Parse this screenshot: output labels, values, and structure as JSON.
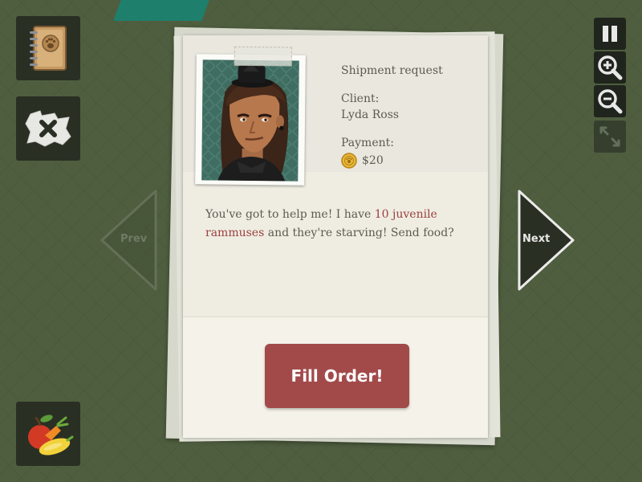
{
  "request": {
    "heading": "Shipment request",
    "client_label": "Client:",
    "client_name": "Lyda Ross",
    "payment_label": "Payment:",
    "payment_amount": "$20",
    "message": {
      "part1": "You've got to help me! I have ",
      "highlight1": "10 juvenile",
      "line_break_highlight": "rammuses",
      "part2": " and they're starving! Send food?"
    }
  },
  "navigation": {
    "prev_label": "Prev",
    "next_label": "Next"
  },
  "actions": {
    "fill_order_label": "Fill Order!"
  },
  "controls": [
    "pause-icon",
    "zoom-in-icon",
    "zoom-out-icon",
    "fullscreen-icon"
  ],
  "sidebar": [
    "journal-icon",
    "map-close-icon",
    "food-icon"
  ],
  "colors": {
    "background": "#4f5e3f",
    "button": "#a24a4a",
    "highlight_text": "#9c3f3f"
  }
}
